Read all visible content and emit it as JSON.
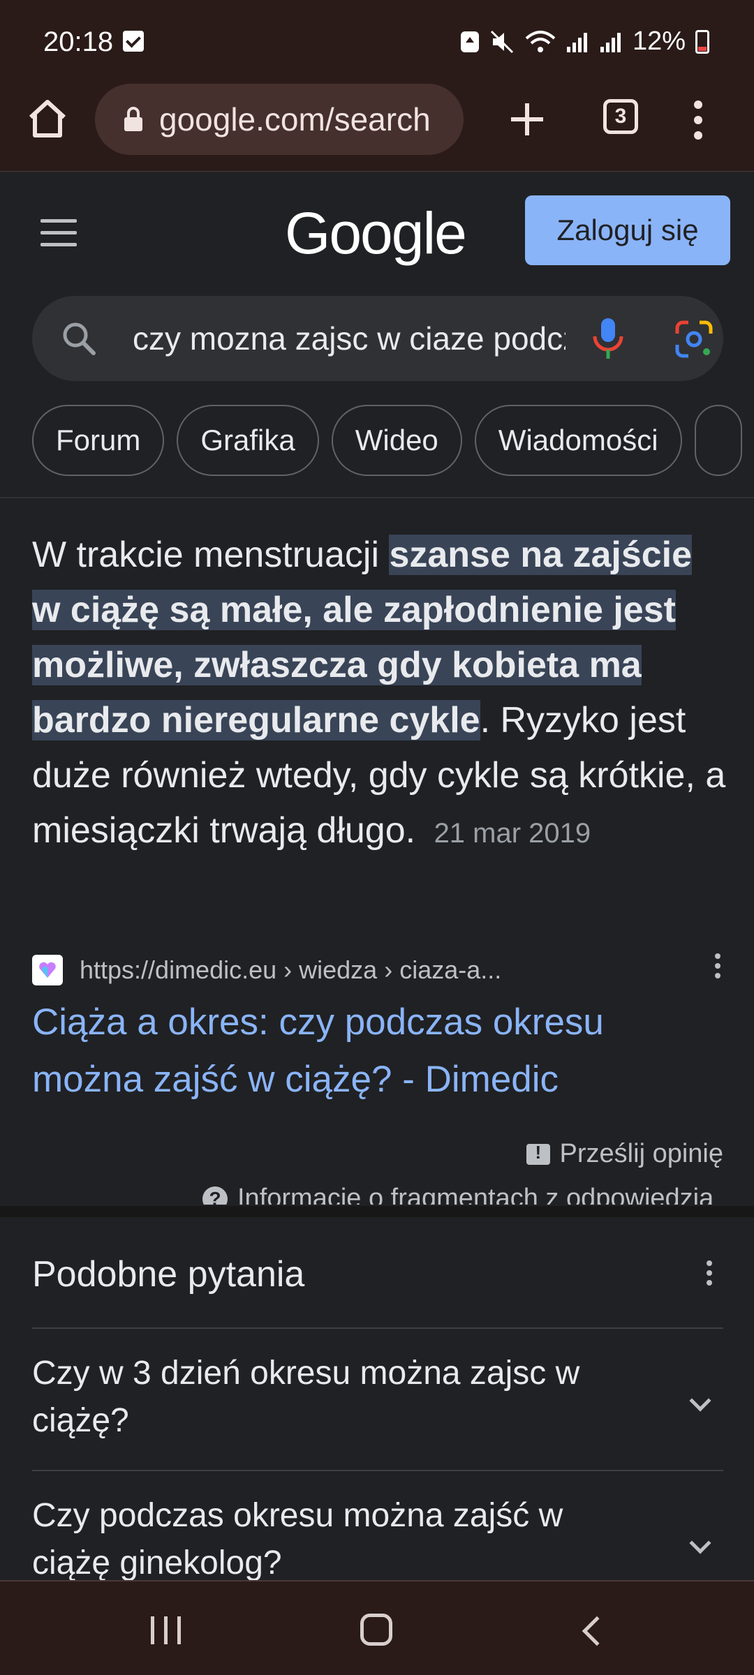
{
  "status_bar": {
    "time": "20:18",
    "battery": "12%",
    "battery_level": 0.12
  },
  "browser": {
    "url": "google.com/search",
    "tab_count": "3"
  },
  "header": {
    "logo": "Google",
    "signin_label": "Zaloguj się"
  },
  "search": {
    "query": "czy mozna zajsc w ciaze podczas okresu"
  },
  "chips": [
    "Forum",
    "Grafika",
    "Wideo",
    "Wiadomości"
  ],
  "snippet": {
    "text_before": "W trakcie menstruacji ",
    "highlight": "szanse na zajście w ciążę są małe, ale zapłodnienie jest możliwe, zwłaszcza gdy kobieta ma bardzo nieregularne cykle",
    "text_after": ". Ryzyko jest duże również wtedy, gdy cykle są krótkie, a miesiączki trwają długo.",
    "date": "21 mar 2019",
    "source_url": "https://dimedic.eu › wiedza › ciaza-a...",
    "result_title": "Ciąża a okres: czy podczas okresu można zajść w ciążę? - Dimedic",
    "feedback_label": "Prześlij opinię",
    "info_label": "Informacje o fragmentach z odpowiedzią"
  },
  "related_questions": {
    "title": "Podobne pytania",
    "items": [
      "Czy w 3 dzień okresu można zajsc w ciążę?",
      "Czy podczas okresu można zajść w ciążę ginekolog?"
    ]
  },
  "colors": {
    "accent": "#8ab4f8",
    "highlight": "#394457",
    "background": "#202124",
    "chrome_bar": "#2a1b19"
  }
}
